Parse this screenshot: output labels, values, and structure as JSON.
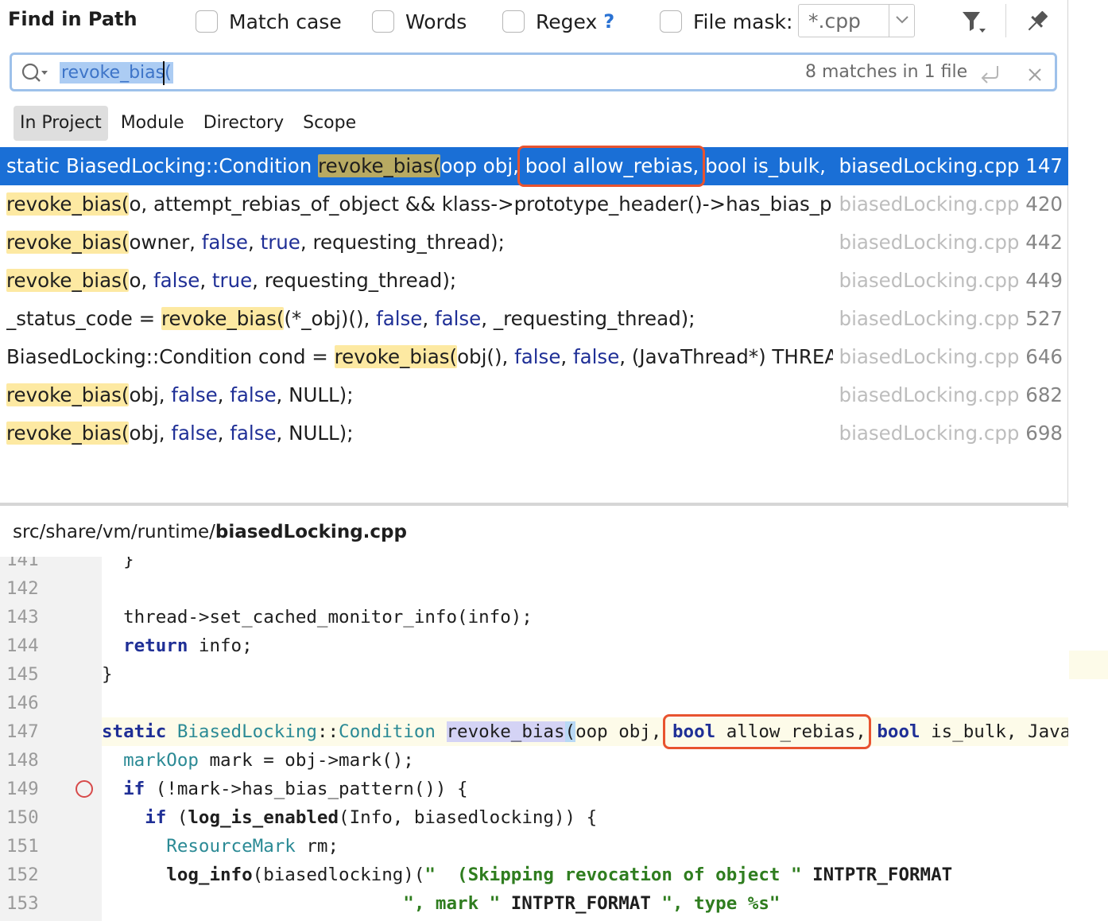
{
  "header": {
    "title": "Find in Path",
    "options": {
      "match_case": "Match case",
      "words": "Words",
      "regex": "Regex",
      "regex_help": "?",
      "file_mask": "File mask:"
    },
    "file_mask_value": "*.cpp"
  },
  "search": {
    "query": "revoke_bias(",
    "count": "8 matches in 1 file"
  },
  "scopes": [
    "In Project",
    "Module",
    "Directory",
    "Scope"
  ],
  "results": [
    {
      "selected": true,
      "parts": [
        [
          "t",
          "static BiasedLocking::Condition "
        ],
        [
          "m",
          "revoke_bias("
        ],
        [
          "t",
          "oop obj, bool allow_rebias, bool is_bulk, "
        ]
      ],
      "file": "biasedLocking.cpp",
      "line": "147"
    },
    {
      "selected": false,
      "parts": [
        [
          "m",
          "revoke_bias("
        ],
        [
          "t",
          "o, attempt_rebias_of_object && klass->prototype_header()->has_bias_pattern()"
        ]
      ],
      "file": "biasedLocking.cpp",
      "line": "420"
    },
    {
      "selected": false,
      "parts": [
        [
          "m",
          "revoke_bias("
        ],
        [
          "t",
          "owner, "
        ],
        [
          "k",
          "false"
        ],
        [
          "t",
          ", "
        ],
        [
          "k",
          "true"
        ],
        [
          "t",
          ", requesting_thread);"
        ]
      ],
      "file": "biasedLocking.cpp",
      "line": "442"
    },
    {
      "selected": false,
      "parts": [
        [
          "m",
          "revoke_bias("
        ],
        [
          "t",
          "o, "
        ],
        [
          "k",
          "false"
        ],
        [
          "t",
          ", "
        ],
        [
          "k",
          "true"
        ],
        [
          "t",
          ", requesting_thread);"
        ]
      ],
      "file": "biasedLocking.cpp",
      "line": "449"
    },
    {
      "selected": false,
      "parts": [
        [
          "t",
          "_status_code = "
        ],
        [
          "m",
          "revoke_bias("
        ],
        [
          "t",
          "(*_obj)(), "
        ],
        [
          "k",
          "false"
        ],
        [
          "t",
          ", "
        ],
        [
          "k",
          "false"
        ],
        [
          "t",
          ", _requesting_thread);"
        ]
      ],
      "file": "biasedLocking.cpp",
      "line": "527"
    },
    {
      "selected": false,
      "parts": [
        [
          "t",
          "BiasedLocking::Condition cond = "
        ],
        [
          "m",
          "revoke_bias("
        ],
        [
          "t",
          "obj(), "
        ],
        [
          "k",
          "false"
        ],
        [
          "t",
          ", "
        ],
        [
          "k",
          "false"
        ],
        [
          "t",
          ", (JavaThread*) THREAD);"
        ]
      ],
      "file": "biasedLocking.cpp",
      "line": "646"
    },
    {
      "selected": false,
      "parts": [
        [
          "m",
          "revoke_bias("
        ],
        [
          "t",
          "obj, "
        ],
        [
          "k",
          "false"
        ],
        [
          "t",
          ", "
        ],
        [
          "k",
          "false"
        ],
        [
          "t",
          ", NULL);"
        ]
      ],
      "file": "biasedLocking.cpp",
      "line": "682"
    },
    {
      "selected": false,
      "parts": [
        [
          "m",
          "revoke_bias("
        ],
        [
          "t",
          "obj, "
        ],
        [
          "k",
          "false"
        ],
        [
          "t",
          ", "
        ],
        [
          "k",
          "false"
        ],
        [
          "t",
          ", NULL);"
        ]
      ],
      "file": "biasedLocking.cpp",
      "line": "698"
    }
  ],
  "preview": {
    "path_prefix": "src/share/vm/runtime/",
    "file_name": "biasedLocking.cpp"
  },
  "editor": {
    "lines": [
      {
        "num": "141",
        "parts": [
          [
            "t",
            "  }"
          ]
        ]
      },
      {
        "num": "142",
        "parts": []
      },
      {
        "num": "143",
        "parts": [
          [
            "t",
            "  thread->set_cached_monitor_info(info);"
          ]
        ]
      },
      {
        "num": "144",
        "parts": [
          [
            "t",
            "  "
          ],
          [
            "k",
            "return"
          ],
          [
            "t",
            " info;"
          ]
        ]
      },
      {
        "num": "145",
        "parts": [
          [
            "t",
            "}"
          ]
        ]
      },
      {
        "num": "146",
        "parts": []
      },
      {
        "num": "147",
        "current": true,
        "parts": [
          [
            "k",
            "static"
          ],
          [
            "t",
            " "
          ],
          [
            "c",
            "BiasedLocking"
          ],
          [
            "t",
            "::"
          ],
          [
            "c",
            "Condition"
          ],
          [
            "t",
            " "
          ],
          [
            "h",
            "revoke_bias"
          ],
          [
            "p",
            "("
          ],
          [
            "t",
            "oop obj, "
          ],
          [
            "k",
            "bool"
          ],
          [
            "t",
            " allow_rebias, "
          ],
          [
            "k",
            "bool"
          ],
          [
            "t",
            " is_bulk, JavaThread* requesting_thread"
          ]
        ]
      },
      {
        "num": "148",
        "parts": [
          [
            "t",
            "  "
          ],
          [
            "c",
            "markOop"
          ],
          [
            "t",
            " mark = obj->mark();"
          ]
        ]
      },
      {
        "num": "149",
        "breakpoint": true,
        "parts": [
          [
            "t",
            "  "
          ],
          [
            "k",
            "if"
          ],
          [
            "t",
            " (!mark->has_bias_pattern()) {"
          ]
        ]
      },
      {
        "num": "150",
        "parts": [
          [
            "t",
            "    "
          ],
          [
            "k",
            "if"
          ],
          [
            "t",
            " ("
          ],
          [
            "f",
            "log_is_enabled"
          ],
          [
            "t",
            "(Info, biasedlocking)) {"
          ]
        ]
      },
      {
        "num": "151",
        "parts": [
          [
            "t",
            "      "
          ],
          [
            "c",
            "ResourceMark"
          ],
          [
            "t",
            " rm;"
          ]
        ]
      },
      {
        "num": "152",
        "parts": [
          [
            "t",
            "      "
          ],
          [
            "f",
            "log_info"
          ],
          [
            "t",
            "(biasedlocking)("
          ],
          [
            "s",
            "\"  (Skipping revocation of object \" "
          ],
          [
            "f",
            "INTPTR_FORMAT"
          ]
        ]
      },
      {
        "num": "153",
        "parts": [
          [
            "t",
            "                            "
          ],
          [
            "s",
            "\", mark \" "
          ],
          [
            "f",
            "INTPTR_FORMAT"
          ],
          [
            "s",
            " \", type %s\""
          ]
        ]
      }
    ]
  },
  "colors": {
    "selection": "#1a6fd6",
    "match_highlight": "#fde9a2",
    "callout": "#e8532f",
    "keyword": "#1f2f96",
    "string": "#2f7d1f",
    "type": "#2b8a95"
  }
}
